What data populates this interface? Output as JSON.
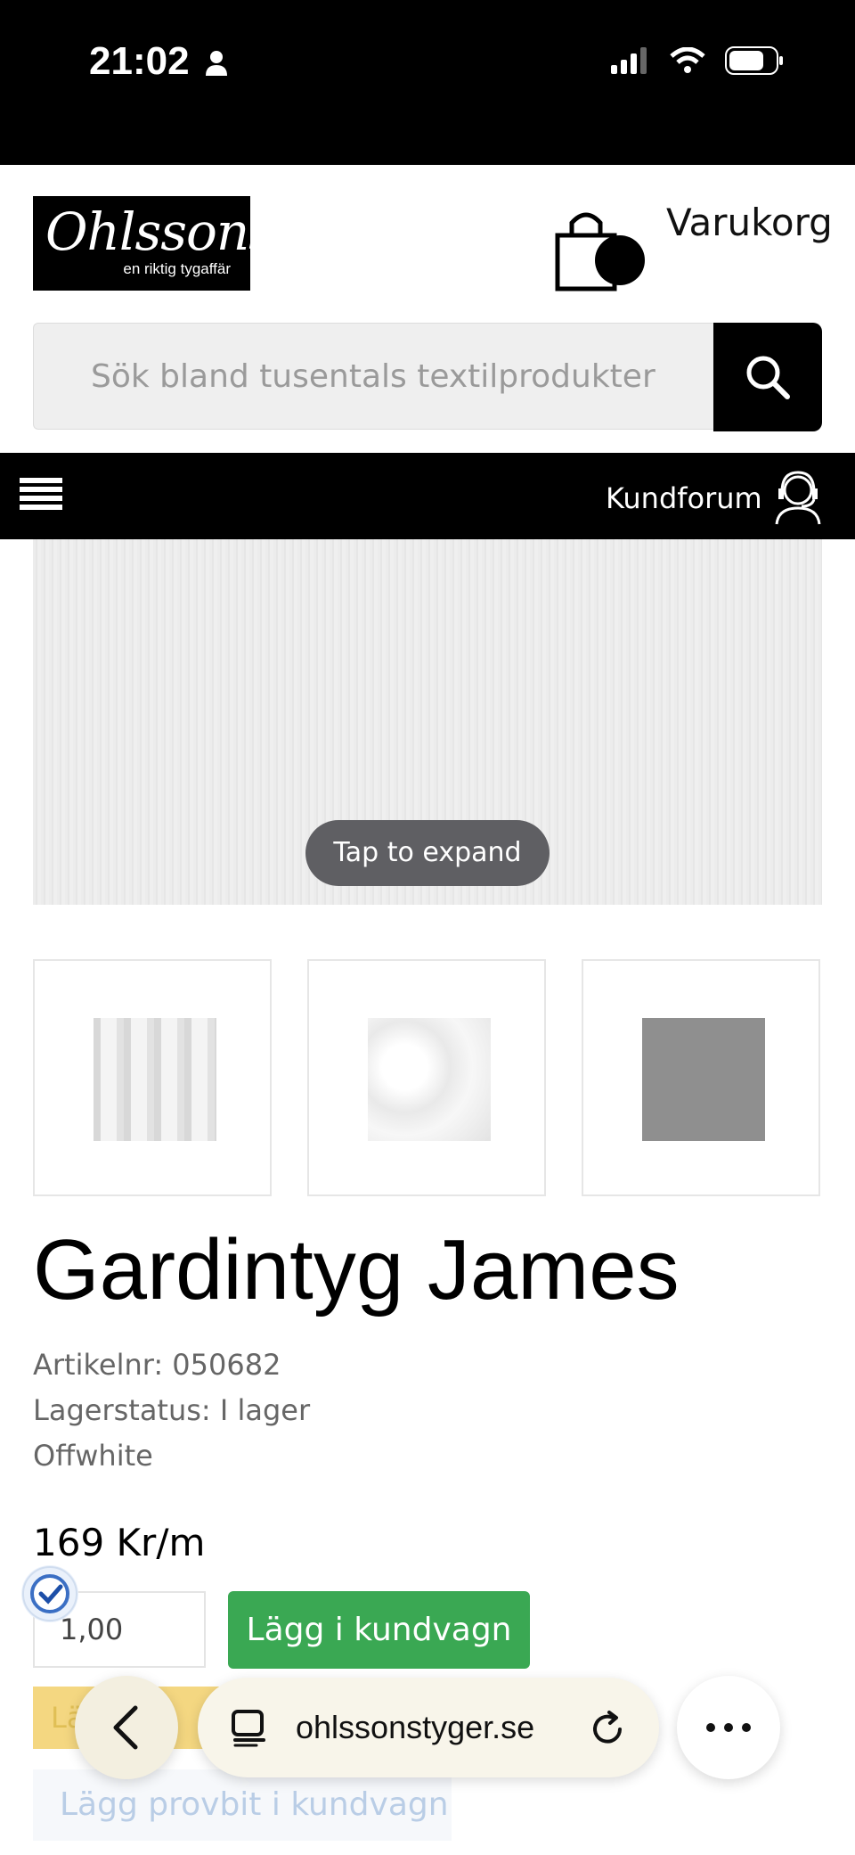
{
  "status": {
    "time": "21:02"
  },
  "header": {
    "logo_main": "Ohlssons",
    "logo_sub": "en riktig tygaffär",
    "cart_label": "Varukorg",
    "search_placeholder": "Sök bland tusentals textilprodukter"
  },
  "nav": {
    "kundforum": "Kundforum"
  },
  "hero": {
    "expand_label": "Tap to expand"
  },
  "product": {
    "title": "Gardintyg James",
    "artikel_label": "Artikelnr:",
    "artikel_value": "050682",
    "lager_label": "Lagerstatus:",
    "lager_value": "I lager",
    "color": "Offwhite",
    "price": "169 Kr/m",
    "quantity": "1,00",
    "add_to_cart": "Lägg i kundvagn",
    "yellow_partial": "Lä",
    "sample_button": "Lägg provbit i kundvagn"
  },
  "browser": {
    "url": "ohlssonstyger.se"
  },
  "colors": {
    "add_button": "#3aa853",
    "nav_bg": "#000000"
  }
}
